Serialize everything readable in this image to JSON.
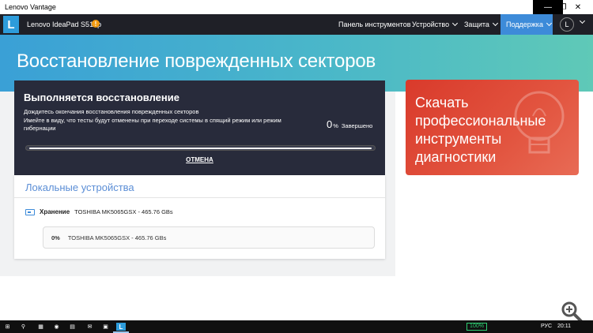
{
  "window": {
    "title": "Lenovo Vantage"
  },
  "nav": {
    "logo": "L",
    "device_name": "Lenovo IdeaPad S510p",
    "alert_badge": "!",
    "dashboard": "Панель инструментов",
    "device": "Устройство",
    "security": "Защита",
    "support": "Поддержка",
    "avatar": "L"
  },
  "hero": {
    "title": "Восстановление поврежденных секторов"
  },
  "progress": {
    "title": "Выполняется восстановление",
    "subtitle": "Дождитесь окончания восстановления поврежденных секторов",
    "note": "Имейте в виду, что тесты будут отменены при переходе системы в спящий режим или режим гибернации",
    "percent": "0",
    "percent_unit": "%",
    "status": "Завершено",
    "cancel": "ОТМЕНА"
  },
  "devices": {
    "title": "Локальные устройства",
    "storage_label": "Хранение",
    "storage_model": "TOSHIBA MK5065GSX - 465.76 GBs",
    "item_percent": "0%",
    "item_model": "TOSHIBA MK5065GSX - 465.76 GBs"
  },
  "promo": {
    "text": "Скачать профессиональные инструменты диагностики"
  },
  "taskbar": {
    "vantage_icon": "L",
    "battery": "100%",
    "language": "РУС",
    "time": "20:11"
  },
  "colors": {
    "nav_bg": "#1f2027",
    "support_accent": "#3d8bd9",
    "card_bg": "#282b3b",
    "promo_bg": "#d93a2b",
    "link_blue": "#5b8ed6"
  }
}
